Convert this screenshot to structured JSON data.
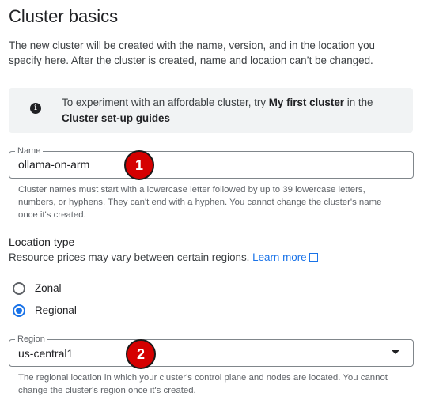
{
  "page": {
    "title": "Cluster basics",
    "description": "The new cluster will be created with the name, version, and in the location you specify here. After the cluster is created, name and location can’t be changed."
  },
  "info": {
    "icon": "info-icon",
    "text_before": "To experiment with an affordable cluster, try ",
    "bold1": "My first cluster",
    "text_mid": " in the ",
    "bold2": "Cluster set-up guides"
  },
  "name_field": {
    "label": "Name",
    "value": "ollama-on-arm",
    "hint": "Cluster names must start with a lowercase letter followed by up to 39 lowercase letters, numbers, or hyphens. They can't end with a hyphen. You cannot change the cluster's name once it's created."
  },
  "location": {
    "title": "Location type",
    "desc": "Resource prices may vary between certain regions. ",
    "link": "Learn more",
    "link_icon": "open-in-new-icon",
    "options": [
      {
        "label": "Zonal",
        "selected": false
      },
      {
        "label": "Regional",
        "selected": true
      }
    ]
  },
  "region_field": {
    "label": "Region",
    "value": "us-central1",
    "dropdown_icon": "arrow-drop-down-icon",
    "hint": "The regional location in which your cluster's control plane and nodes are located. You cannot change the cluster's region once it's created."
  },
  "annotations": [
    {
      "label": "1"
    },
    {
      "label": "2"
    }
  ],
  "colors": {
    "accent": "#1a73e8",
    "badge": "#d50000",
    "info_bg": "#f1f3f4"
  }
}
